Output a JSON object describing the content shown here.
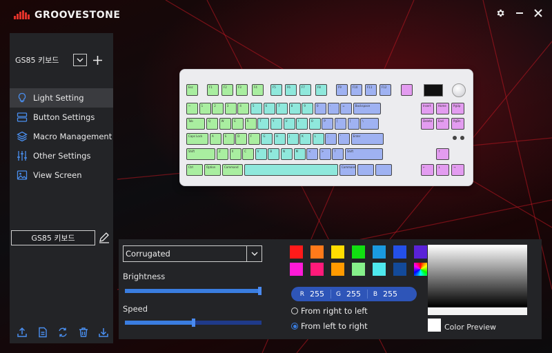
{
  "app": {
    "brand": "GROOVESTONE"
  },
  "colors": {
    "accent": "#3a7de0",
    "panel": "#232427",
    "brand_red": "#e0322a"
  },
  "sidebar": {
    "device_name": "GS85 키보드",
    "profile_name": "GS85 키보드",
    "items": [
      {
        "label": "Light Setting",
        "icon": "bulb-icon",
        "active": true
      },
      {
        "label": "Button Settings",
        "icon": "buttons-icon",
        "active": false
      },
      {
        "label": "Macro Management",
        "icon": "layers-icon",
        "active": false
      },
      {
        "label": "Other Settings",
        "icon": "sliders-icon",
        "active": false
      },
      {
        "label": "View Screen",
        "icon": "image-icon",
        "active": false
      }
    ],
    "tools": [
      "upload-icon",
      "document-icon",
      "sync-icon",
      "trash-icon",
      "download-icon"
    ]
  },
  "keyboard": {
    "fn_row": [
      "Esc",
      "F1",
      "F2",
      "F3",
      "F4",
      "F5",
      "F6",
      "F7",
      "F8",
      "F9",
      "F10",
      "F11",
      "F12"
    ],
    "num_row": [
      "~",
      "1",
      "2",
      "3",
      "4",
      "5",
      "6",
      "7",
      "8",
      "9",
      "0",
      "-",
      "="
    ],
    "backspace": "Backspace",
    "tab": "Tab",
    "caps": "Caps Lock",
    "shift": "Shift",
    "ctrl": "Ctrl",
    "option": "Option",
    "command": "Command",
    "enter": "Enter",
    "row_q": [
      "Q",
      "W",
      "E",
      "R",
      "T",
      "Y",
      "U",
      "I",
      "O",
      "P",
      "[",
      "]",
      "\\"
    ],
    "row_a": [
      "A",
      "S",
      "D",
      "F",
      "G",
      "H",
      "J",
      "K",
      "L",
      ";",
      "'"
    ],
    "row_z": [
      "Z",
      "X",
      "C",
      "V",
      "B",
      "N",
      "M",
      "<",
      ">",
      "?"
    ],
    "nav": [
      "Insert",
      "Home",
      "PgUp",
      "Delete",
      "End",
      "PgDn"
    ]
  },
  "lighting": {
    "effect": "Corrugated",
    "brightness_label": "Brightness",
    "speed_label": "Speed",
    "brightness": 1.0,
    "speed": 0.5,
    "swatches": [
      "#ff1a1a",
      "#ff7a1a",
      "#ffdd00",
      "#11e011",
      "#1a9ae0",
      "#2450e8",
      "#5a22d8",
      "#ff1ad8",
      "#ff1a7a",
      "#ff9a00",
      "#86f08a",
      "#4ee8ee",
      "#134a9a",
      "rainbow"
    ],
    "rgb": {
      "r_label": "R",
      "g_label": "G",
      "b_label": "B",
      "r": "255",
      "g": "255",
      "b": "255"
    },
    "direction_rl": "From right to left",
    "direction_lr": "From left to right",
    "selected_direction": "lr",
    "preview_label": "Color Preview"
  }
}
